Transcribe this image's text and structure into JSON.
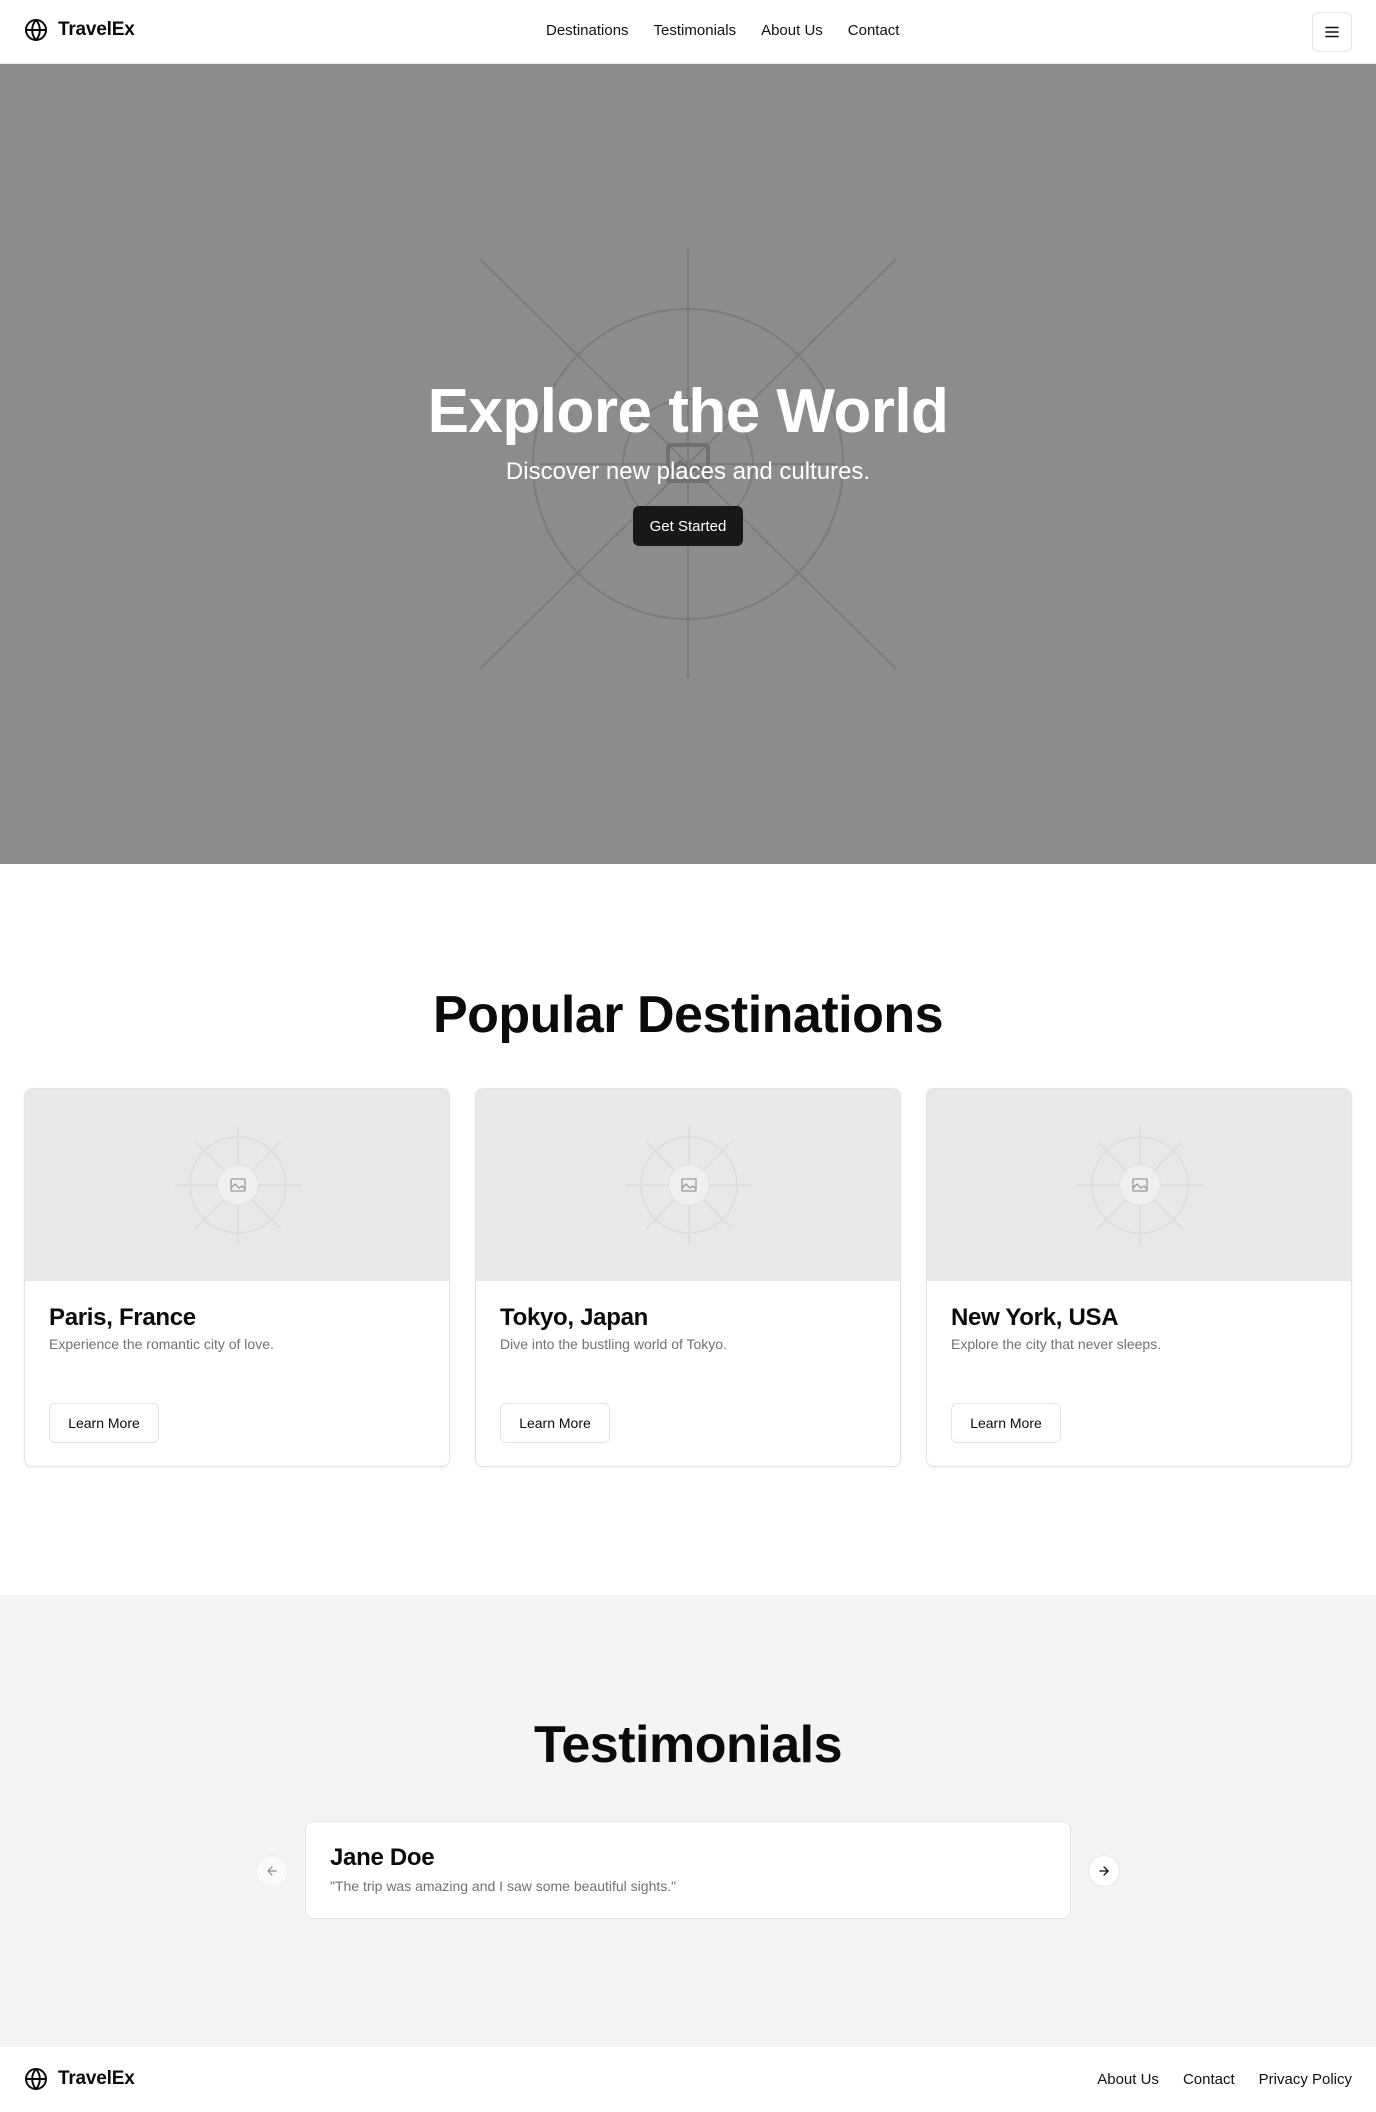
{
  "header": {
    "brand": "TravelEx",
    "nav": [
      "Destinations",
      "Testimonials",
      "About Us",
      "Contact"
    ]
  },
  "hero": {
    "title": "Explore the World",
    "subtitle": "Discover new places and cultures.",
    "cta": "Get Started"
  },
  "destinations": {
    "title": "Popular Destinations",
    "cards": [
      {
        "name": "Paris, France",
        "desc": "Experience the romantic city of love.",
        "button": "Learn More"
      },
      {
        "name": "Tokyo, Japan",
        "desc": "Dive into the bustling world of Tokyo.",
        "button": "Learn More"
      },
      {
        "name": "New York, USA",
        "desc": "Explore the city that never sleeps.",
        "button": "Learn More"
      }
    ]
  },
  "testimonials": {
    "title": "Testimonials",
    "name": "Jane Doe",
    "quote": "\"The trip was amazing and I saw some beautiful sights.\""
  },
  "footer": {
    "brand": "TravelEx",
    "links": [
      "About Us",
      "Contact",
      "Privacy Policy"
    ]
  },
  "colors": {
    "hero_bg": "#8c8c8c",
    "primary_button": "#18181b",
    "muted_text": "#71717a",
    "section_bg": "#f3f4f6"
  }
}
